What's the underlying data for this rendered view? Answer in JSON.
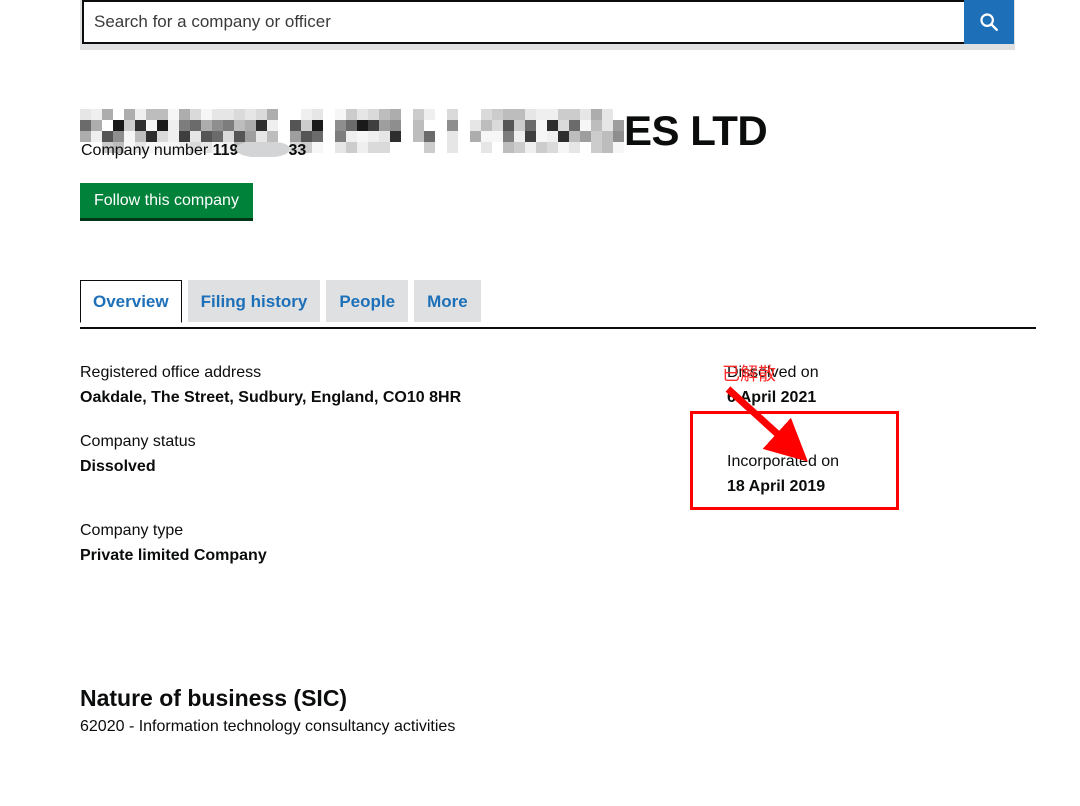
{
  "search": {
    "placeholder": "Search for a company or officer",
    "value": "",
    "button_icon": "search-icon",
    "button_color": "#1d70b8"
  },
  "company": {
    "name_visible_suffix": "ES LTD",
    "name_redacted": true,
    "number_label": "Company number",
    "number_prefix": "119",
    "number_suffix": "33",
    "number_redacted": true,
    "follow_button_label": "Follow this company",
    "follow_button_color": "#00823b"
  },
  "tabs": [
    {
      "label": "Overview",
      "active": true
    },
    {
      "label": "Filing history",
      "active": false
    },
    {
      "label": "People",
      "active": false
    },
    {
      "label": "More",
      "active": false
    }
  ],
  "overview": {
    "left": [
      {
        "label": "Registered office address",
        "value": "Oakdale, The Street, Sudbury, England, CO10 8HR"
      },
      {
        "label": "Company status",
        "value": "Dissolved"
      },
      {
        "label": "Company type",
        "value": "Private limited Company"
      }
    ],
    "right": [
      {
        "label": "Dissolved on",
        "value": "6 April 2021"
      },
      {
        "label": "Incorporated on",
        "value": "18 April 2019"
      }
    ]
  },
  "sic": {
    "heading": "Nature of business (SIC)",
    "items": [
      "62020 - Information technology consultancy activities"
    ]
  },
  "annotation": {
    "text": "已解散",
    "color": "#ff0000",
    "highlight_target": "Dissolved on 6 April 2021"
  }
}
